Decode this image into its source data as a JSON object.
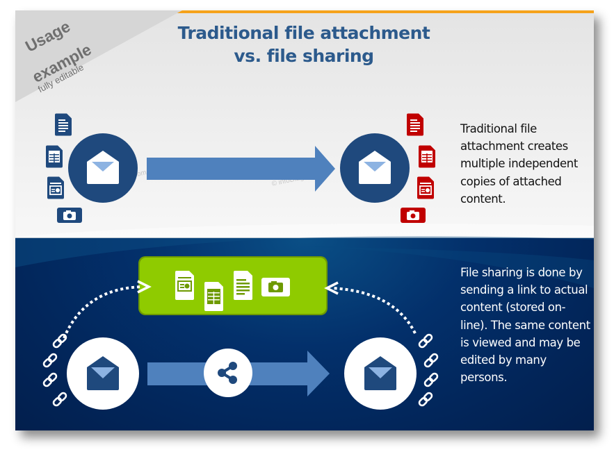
{
  "badge": {
    "line1": "Usage",
    "line2": "example",
    "line3": "fully editable"
  },
  "title": {
    "line1": "Traditional file attachment",
    "line2": "vs. file sharing"
  },
  "watermarks": [
    "© infoDiagram.com",
    "com"
  ],
  "traditional": {
    "description": "Traditional file attachment creates multiple independent copies of attached content.",
    "source_files": [
      "document-icon",
      "spreadsheet-icon",
      "presentation-icon",
      "camera-icon"
    ],
    "copy_files": [
      "document-icon",
      "spreadsheet-icon",
      "presentation-icon",
      "camera-icon"
    ],
    "source_file_color": "#1f497d",
    "copy_file_color": "#c00000"
  },
  "sharing": {
    "description": "File sharing is done by sending a link to actual content (stored on-line). The same content is viewed and may be edited by many persons.",
    "cloud_files": [
      "presentation-icon",
      "spreadsheet-icon",
      "document-icon",
      "camera-icon"
    ],
    "storage_color": "#8fcb00",
    "link_count_each_side": 4
  },
  "colors": {
    "accent_bar": "#f5a21b",
    "title": "#2c5a8c",
    "circle": "#1f497d",
    "arrow": "#4f81bd"
  }
}
